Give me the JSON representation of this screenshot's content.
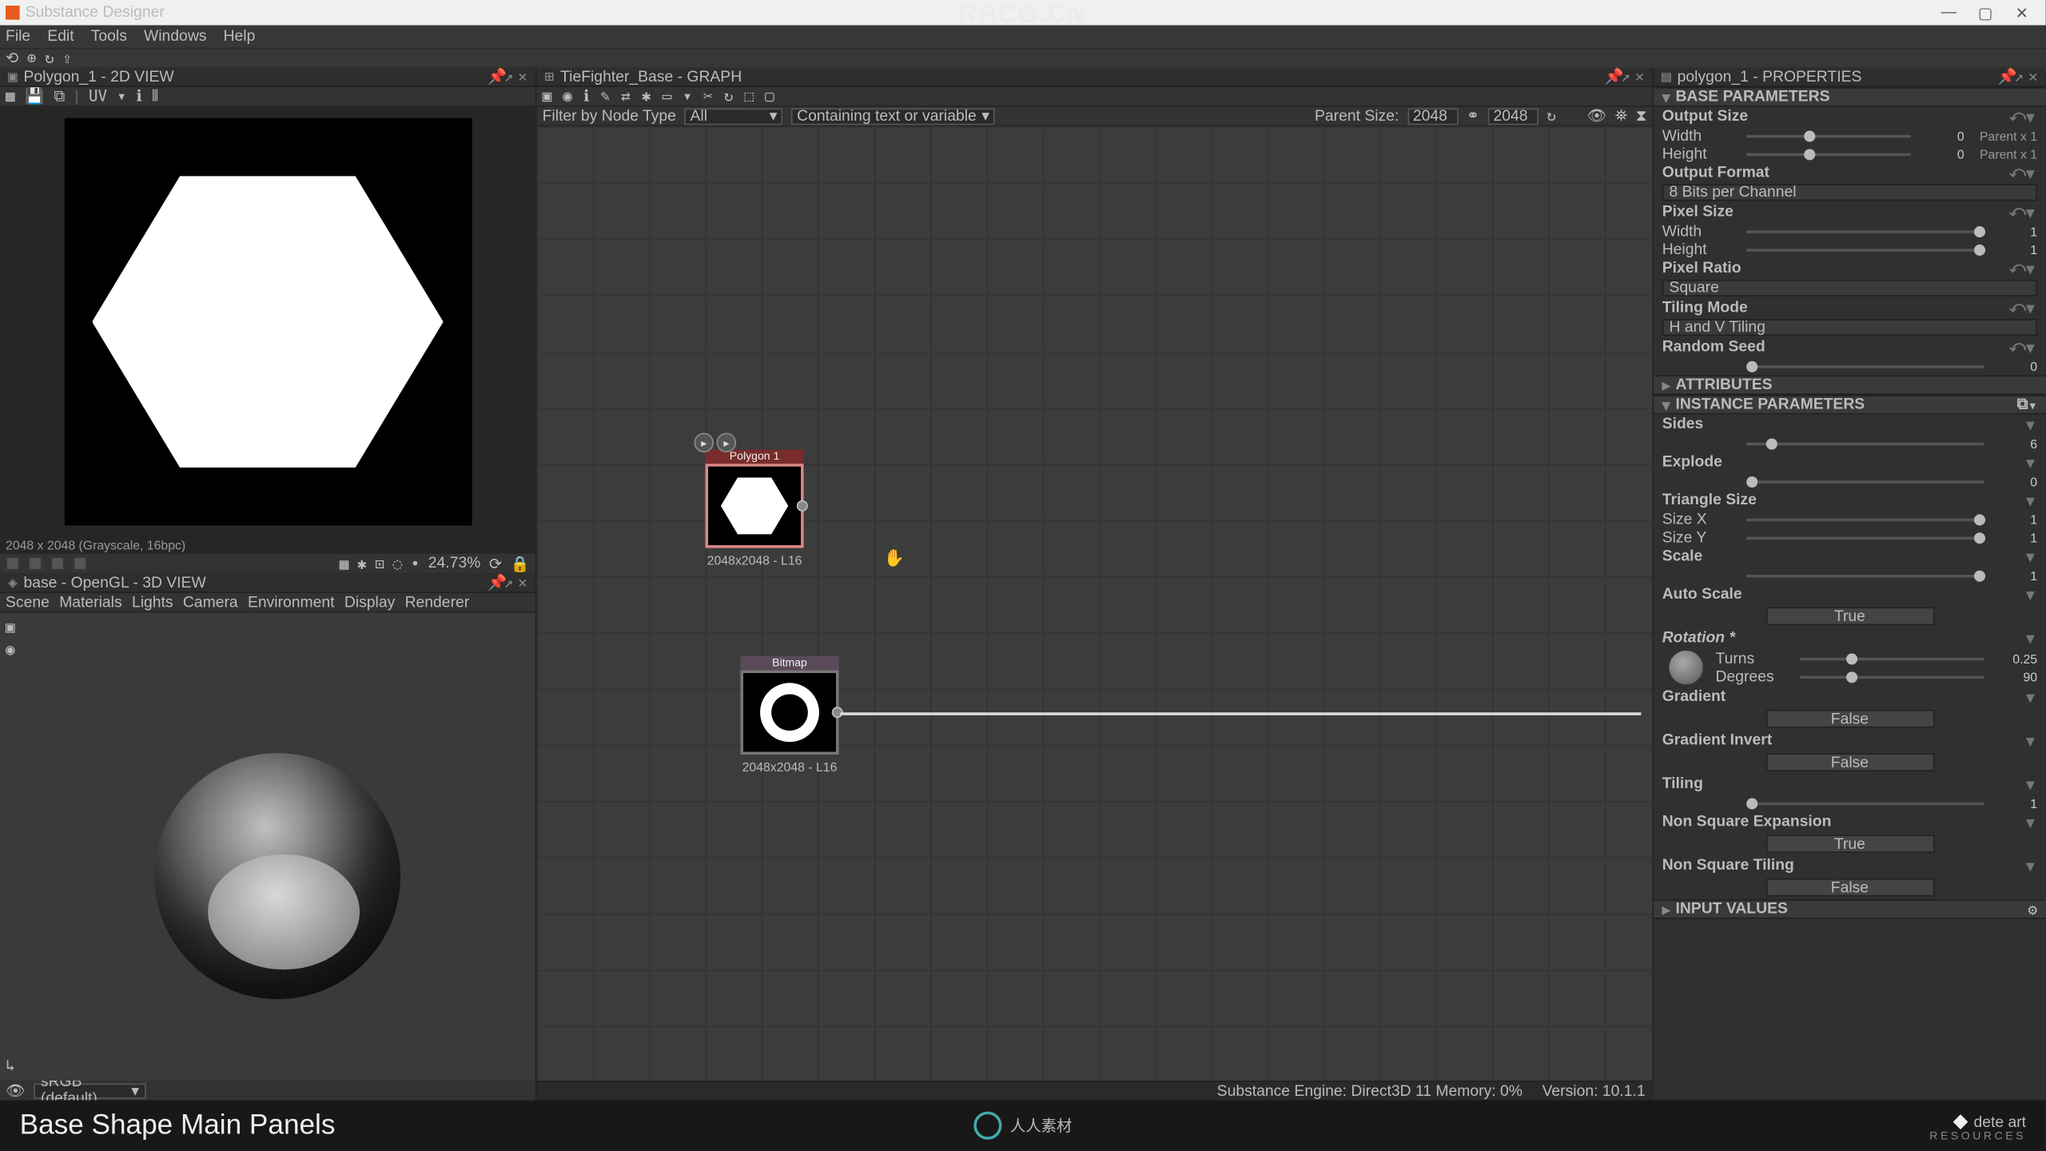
{
  "app": {
    "title": "Substance Designer"
  },
  "menus": [
    "File",
    "Edit",
    "Tools",
    "Windows",
    "Help"
  ],
  "panels": {
    "view2d": {
      "tab": "Polygon_1 - 2D VIEW",
      "status": "2048 x 2048 (Grayscale, 16bpc)",
      "zoom": "24.73%"
    },
    "view3d": {
      "tab": "base - OpenGL - 3D VIEW",
      "menu": [
        "Scene",
        "Materials",
        "Lights",
        "Camera",
        "Environment",
        "Display",
        "Renderer"
      ],
      "colorspace": "sRGB (default)"
    },
    "graph": {
      "tab": "TieFighter_Base - GRAPH",
      "filter_label": "Filter by Node Type",
      "filter_value": "All",
      "search_placeholder": "Containing text or variable",
      "parent_label": "Parent Size:",
      "parent_w": "2048",
      "parent_h": "2048",
      "nodes": {
        "poly": {
          "title": "Polygon 1",
          "caption": "2048x2048 - L16"
        },
        "bitmap": {
          "title": "Bitmap",
          "caption": "2048x2048 - L16"
        }
      }
    },
    "props": {
      "tab": "polygon_1 - PROPERTIES",
      "sections": {
        "base": "BASE PARAMETERS",
        "attrs": "ATTRIBUTES",
        "inst": "INSTANCE PARAMETERS",
        "input": "INPUT VALUES"
      },
      "output_size": {
        "label": "Output Size",
        "width_lbl": "Width",
        "height_lbl": "Height",
        "width": "0",
        "height": "0",
        "width_extra": "Parent x 1",
        "height_extra": "Parent x 1"
      },
      "output_format": {
        "label": "Output Format",
        "value": "8 Bits per Channel"
      },
      "pixel_size": {
        "label": "Pixel Size",
        "width_lbl": "Width",
        "height_lbl": "Height",
        "width": "1",
        "height": "1"
      },
      "pixel_ratio": {
        "label": "Pixel Ratio",
        "value": "Square"
      },
      "tiling_mode": {
        "label": "Tiling Mode",
        "value": "H and V Tiling"
      },
      "random_seed": {
        "label": "Random Seed",
        "value": "0"
      },
      "sides": {
        "label": "Sides",
        "value": "6"
      },
      "explode": {
        "label": "Explode",
        "value": "0"
      },
      "triangle_size": {
        "label": "Triangle Size",
        "sx_lbl": "Size X",
        "sy_lbl": "Size Y",
        "sx": "1",
        "sy": "1"
      },
      "scale": {
        "label": "Scale",
        "value": "1"
      },
      "auto_scale": {
        "label": "Auto Scale",
        "value": "True"
      },
      "rotation": {
        "label": "Rotation *",
        "turns_lbl": "Turns",
        "degrees_lbl": "Degrees",
        "turns": "0.25",
        "degrees": "90"
      },
      "gradient": {
        "label": "Gradient",
        "value": "False"
      },
      "gradient_invert": {
        "label": "Gradient Invert",
        "value": "False"
      },
      "tiling": {
        "label": "Tiling",
        "value": "1"
      },
      "nsq_exp": {
        "label": "Non Square Expansion",
        "value": "True"
      },
      "nsq_tiling": {
        "label": "Non Square Tiling",
        "value": "False"
      }
    }
  },
  "statusbar": {
    "engine": "Substance Engine: Direct3D 11  Memory: 0%",
    "version": "Version: 10.1.1"
  },
  "footer": {
    "title": "Base Shape Main Panels",
    "brand": "dete art",
    "brand2": "RESOURCES"
  },
  "watermark_top": "RRCG.CN"
}
